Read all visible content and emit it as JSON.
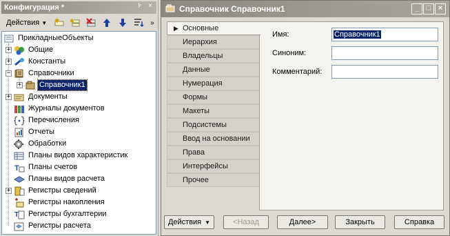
{
  "config_panel": {
    "title": "Конфигурация *",
    "title_buttons": [
      "pin-icon",
      "close-icon"
    ],
    "toolbar": {
      "actions_label": "Действия",
      "buttons": [
        "add-icon",
        "add-child-icon",
        "delete-icon",
        "move-up-icon",
        "move-down-icon",
        "sort-icon"
      ],
      "more": "»"
    },
    "tree": {
      "root": "ПрикладныеОбъекты",
      "items": [
        {
          "label": "Общие",
          "icon": "general-icon",
          "expander": "+"
        },
        {
          "label": "Константы",
          "icon": "constants-icon",
          "expander": "+"
        },
        {
          "label": "Справочники",
          "icon": "catalogs-icon",
          "expander": "−"
        },
        {
          "label": "Справочник1",
          "icon": "catalog-item-icon",
          "expander": "+",
          "selected": true
        },
        {
          "label": "Документы",
          "icon": "documents-icon",
          "expander": "+"
        },
        {
          "label": "Журналы документов",
          "icon": "journals-icon",
          "expander": ""
        },
        {
          "label": "Перечисления",
          "icon": "enums-icon",
          "expander": ""
        },
        {
          "label": "Отчеты",
          "icon": "reports-icon",
          "expander": ""
        },
        {
          "label": "Обработки",
          "icon": "processing-icon",
          "expander": ""
        },
        {
          "label": "Планы видов характеристик",
          "icon": "char-plans-icon",
          "expander": ""
        },
        {
          "label": "Планы счетов",
          "icon": "accounts-plans-icon",
          "expander": ""
        },
        {
          "label": "Планы видов расчета",
          "icon": "calc-plans-icon",
          "expander": ""
        },
        {
          "label": "Регистры сведений",
          "icon": "info-registers-icon",
          "expander": "+"
        },
        {
          "label": "Регистры накопления",
          "icon": "accum-registers-icon",
          "expander": ""
        },
        {
          "label": "Регистры бухгалтерии",
          "icon": "acc-registers-icon",
          "expander": ""
        },
        {
          "label": "Регистры расчета",
          "icon": "calc-registers-icon",
          "expander": ""
        }
      ]
    }
  },
  "dialog": {
    "title": "Справочник Справочник1",
    "controls": [
      "minimize-icon",
      "maximize-icon",
      "close-icon"
    ],
    "tabs": [
      {
        "label": "Основные",
        "active": true
      },
      {
        "label": "Иерархия"
      },
      {
        "label": "Владельцы"
      },
      {
        "label": "Данные"
      },
      {
        "label": "Нумерация"
      },
      {
        "label": "Формы"
      },
      {
        "label": "Макеты"
      },
      {
        "label": "Подсистемы"
      },
      {
        "label": "Ввод на основании"
      },
      {
        "label": "Права"
      },
      {
        "label": "Интерфейсы"
      },
      {
        "label": "Прочее"
      }
    ],
    "fields": {
      "name_label": "Имя:",
      "name_value": "Справочник1",
      "synonym_label": "Синоним:",
      "synonym_value": "",
      "comment_label": "Комментарий:",
      "comment_value": ""
    },
    "buttons": {
      "actions": "Действия",
      "back": "<Назад",
      "next": "Далее>",
      "close": "Закрыть",
      "help": "Справка"
    }
  },
  "colors": {
    "selection": "#0a246a",
    "title_bar": "#8e8b83",
    "panel_bg": "#dcd9d2"
  }
}
